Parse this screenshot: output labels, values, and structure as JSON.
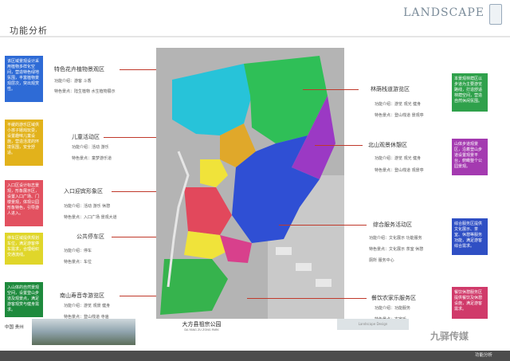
{
  "header": {
    "title": "功能分析",
    "logo": "LANDSCAPE"
  },
  "left_boxes": [
    {
      "id": "box1",
      "color": "#2e6bd6",
      "text": "该区域景观设计采用植物多样化空间，营造特色绿地氛围，丰富植物景观层次，突出观赏性。"
    },
    {
      "id": "box2",
      "color": "#e2b21b",
      "text": "平缓的游乐区域供小孩子嬉戏玩耍，设置趣味儿童设施，营造活泼的环境氛围，安全舒适。"
    },
    {
      "id": "box3",
      "color": "#e25160",
      "text": "入口区设计标志景观，形象展示区，设置入口广场、门楼景观，体现公园形象特色，引导游人进入。"
    },
    {
      "id": "box4",
      "color": "#e0d62a",
      "text": "停车区域提供规划车位，满足游客停车需求，合理组织交通流线。"
    },
    {
      "id": "box5",
      "color": "#1e8a3d",
      "text": "入山体的自然景观空间，设置登山步道及观景点，满足游客观赏与健身需求。"
    }
  ],
  "right_boxes": [
    {
      "id": "rbox1",
      "color": "#2fa14b",
      "text": "本景观林荫区以步道为主要游览路线，打造舒适林荫空间，营造自然休闲氛围。"
    },
    {
      "id": "rbox2",
      "color": "#a43ab0",
      "text": "山体步道观景区，沿着登山步道设置观景平台，俯瞰整个公园景观。"
    },
    {
      "id": "rbox3",
      "color": "#2f4fc4",
      "text": "综合服务区提供文化展示、茶室、休憩等服务功能，满足游客综合需求。"
    },
    {
      "id": "rbox4",
      "color": "#d03a6a",
      "text": "餐饮休憩服务区提供餐饮及休憩设施，满足游客需求。"
    }
  ],
  "zones_left": [
    {
      "title": "特色花卉植物景观区",
      "info1": "功能介绍：游客  斗香",
      "info2": "特色景点：陆生植物  水生植物展示"
    },
    {
      "title": "儿童活动区",
      "info1": "功能介绍：活动  游乐",
      "info2": "特色景点：童梦游乐道"
    },
    {
      "title": "入口迎宾形象区",
      "info1": "功能介绍：活动  游乐  休憩",
      "info2": "特色景点：入口广场  景观大道"
    },
    {
      "title": "公共停车区",
      "info1": "功能介绍：停车",
      "info2": "特色景点：车位"
    },
    {
      "title": "南山寿音寺游览区",
      "info1": "功能介绍：游览  观景  健身",
      "info2": "特色景点：登山栈道  寺庙"
    }
  ],
  "zones_right": [
    {
      "title": "林荫栈道游览区",
      "info1": "功能介绍：游览  观光  健身",
      "info2": "特色景点：登山栈道  景观亭"
    },
    {
      "title": "北山观景休憩区",
      "info1": "功能介绍：游览  观光  健身",
      "info2": "特色景点：登山栈道  观景亭"
    },
    {
      "title": "综合服务活动区",
      "info1": "功能介绍：文化展示  功能服务",
      "info2": "特色景点：文化展示  茶室  休憩",
      "info3": "厕所  服务中心"
    },
    {
      "title": "餐饮农家乐服务区",
      "info1": "功能介绍：功能服务",
      "info2": "特色景点：农家乐"
    }
  ],
  "footer": {
    "left": "中国 贵州",
    "center": "大方县祖宗公园",
    "center_sub": "DA FANG ZU ZONG PARK",
    "right_box": "Landscape Design",
    "watermark": "九驿传媒",
    "page_label": "功能分析"
  }
}
